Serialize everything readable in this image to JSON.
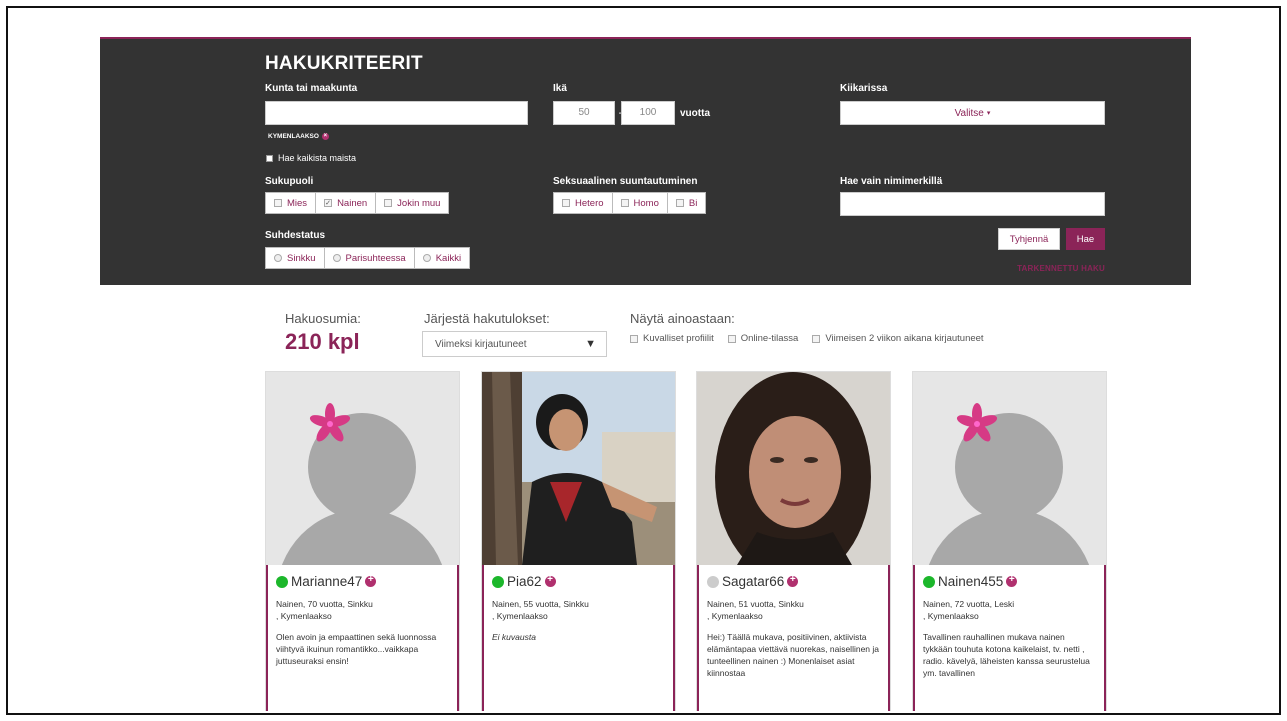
{
  "search_panel": {
    "title": "HAKUKRITEERIT",
    "kunta_label": "Kunta tai maakunta",
    "kunta_value": "",
    "selected_region_tag": "KYMENLAAKSO",
    "all_countries_label": "Hae kaikista maista",
    "age_label": "Ikä",
    "age_min": "50",
    "age_max": "100",
    "age_unit": "vuotta",
    "binoculars_label": "Kiikarissa",
    "binoculars_select": "Valitse",
    "gender_label": "Sukupuoli",
    "gender_options": [
      "Mies",
      "Nainen",
      "Jokin muu"
    ],
    "gender_checked": "Nainen",
    "orientation_label": "Seksuaalinen suuntautuminen",
    "orientation_options": [
      "Hetero",
      "Homo",
      "Bi"
    ],
    "nickname_label": "Hae vain nimimerkillä",
    "nickname_value": "",
    "relationship_label": "Suhdestatus",
    "relationship_options": [
      "Sinkku",
      "Parisuhteessa",
      "Kaikki"
    ],
    "clear_button": "Tyhjennä",
    "search_button": "Hae",
    "advanced_link": "TARKENNETTU HAKU"
  },
  "results_bar": {
    "hits_label": "Hakuosumia:",
    "hits_value": "210 kpl",
    "sort_label": "Järjestä hakutulokset:",
    "sort_value": "Viimeksi kirjautuneet",
    "show_only_label": "Näytä ainoastaan:",
    "filters": [
      "Kuvalliset profiilit",
      "Online-tilassa",
      "Viimeisen 2 viikon aikana kirjautuneet"
    ]
  },
  "profiles": [
    {
      "name": "Marianne47",
      "online": true,
      "meta1": "Nainen, 70 vuotta, Sinkku",
      "meta2": ", Kymenlaakso",
      "description": "Olen avoin ja empaattinen sekä luonnossa viihtyvä ikuinun romantikko...vaikkapa juttuseuraksi ensin!",
      "italic": false,
      "photo": "placeholder"
    },
    {
      "name": "Pia62",
      "online": true,
      "meta1": "Nainen, 55 vuotta, Sinkku",
      "meta2": ", Kymenlaakso",
      "description": "Ei kuvausta",
      "italic": true,
      "photo": "photo"
    },
    {
      "name": "Sagatar66",
      "online": false,
      "meta1": "Nainen, 51 vuotta, Sinkku",
      "meta2": ", Kymenlaakso",
      "description": "Hei:) Täällä mukava, positiivinen, aktiivista elämäntapaa viettävä nuorekas, naisellinen ja tunteellinen nainen :) Monenlaiset asiat kiinnostaa",
      "italic": false,
      "photo": "photo"
    },
    {
      "name": "Nainen455",
      "online": true,
      "meta1": "Nainen, 72 vuotta, Leski",
      "meta2": ", Kymenlaakso",
      "description": "Tavallinen rauhallinen mukava nainen tykkään touhuta kotona kaikelaist, tv. netti , radio. kävelyä, läheisten kanssa seurustelua ym. tavallinen",
      "italic": false,
      "photo": "placeholder"
    }
  ],
  "colors": {
    "accent": "#8b2458",
    "panel_bg": "#333333",
    "online": "#1cb72b",
    "offline": "#cccccc"
  }
}
